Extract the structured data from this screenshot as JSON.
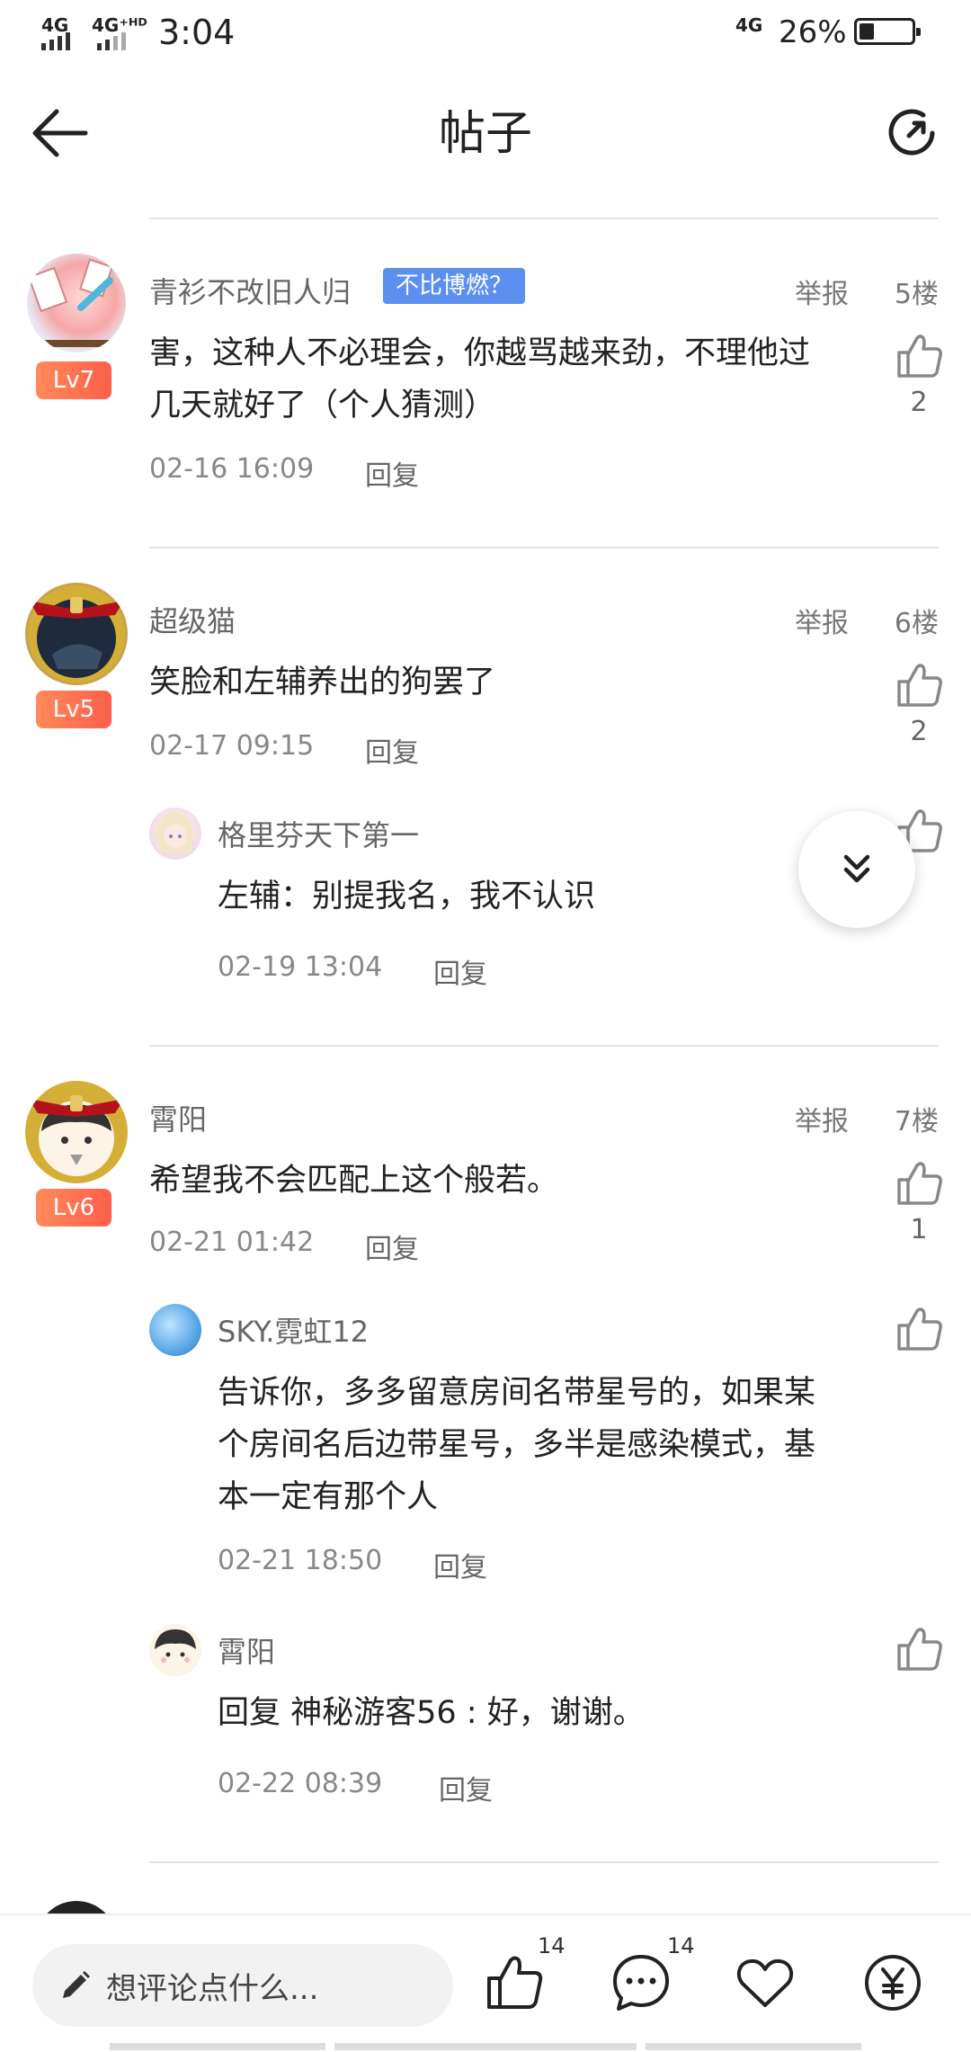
{
  "status_bar": {
    "signal1": "4G",
    "signal2": "4G⁺ᴴᴰ",
    "time": "3:04",
    "net": "4G",
    "battery": "26%",
    "battery_level": 0.26
  },
  "header": {
    "title": "帖子"
  },
  "posts": [
    {
      "name": "青衫不改旧人归",
      "badge": "不比博燃？",
      "level": "Lv7",
      "report": "举报",
      "floor": "5楼",
      "lines": [
        "害，这种人不必理会，你越骂越来劲，不理他过",
        "几天就好了（个人猜测）"
      ],
      "date": "02-16 16:09",
      "reply": "回复",
      "likes": "2"
    },
    {
      "name": "超级猫",
      "level": "Lv5",
      "report": "举报",
      "floor": "6楼",
      "lines": [
        "笑脸和左辅养出的狗罢了"
      ],
      "date": "02-17 09:15",
      "reply": "回复",
      "likes": "2",
      "replies": [
        {
          "name": "格里芬天下第一",
          "lines": [
            "左辅：别提我名，我不认识"
          ],
          "date": "02-19 13:04",
          "reply": "回复"
        }
      ]
    },
    {
      "name": "霄阳",
      "level": "Lv6",
      "report": "举报",
      "floor": "7楼",
      "lines": [
        "希望我不会匹配上这个般若。"
      ],
      "date": "02-21 01:42",
      "reply": "回复",
      "likes": "1",
      "replies": [
        {
          "name": "SKY.霓虹12",
          "lines": [
            "告诉你，多多留意房间名带星号的，如果某",
            "个房间名后边带星号，多半是感染模式，基",
            "本一定有那个人"
          ],
          "date": "02-21 18:50",
          "reply": "回复"
        },
        {
          "name": "霄阳",
          "lines": [
            "回复 神秘游客56 : 好，谢谢。"
          ],
          "date": "02-22 08:39",
          "reply": "回复"
        }
      ]
    }
  ],
  "bottom_bar": {
    "placeholder": "想评论点什么...",
    "like_count": "14",
    "comment_count": "14"
  },
  "icons": [
    "back-arrow-icon",
    "refresh-icon",
    "thumb-up-icon",
    "double-chevron-down-icon",
    "pencil-icon",
    "comment-icon",
    "heart-icon",
    "yen-icon"
  ]
}
